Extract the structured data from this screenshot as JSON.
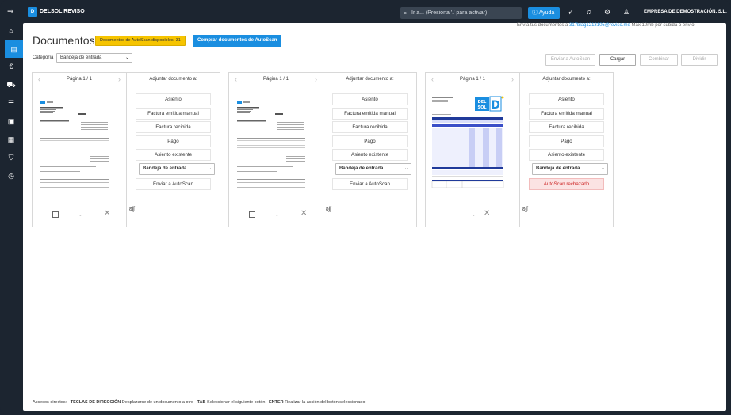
{
  "app": {
    "title": "DELSOL REVISO",
    "logo_text": "D"
  },
  "topbar": {
    "search_placeholder": "Ir a... (Presiona '.' para activar)",
    "help_label": "Ayuda",
    "company": "EMPRESA DE DEMOSTRACIÓN, S.L."
  },
  "header": {
    "email_note_prefix": "Envía tus documentos a ",
    "email": "317blag1213105@reviso.me",
    "email_note_suffix": " Max 10mb por subida o envío.",
    "title": "Documentos",
    "autoscan_badge": "Documentos de AutoScan disponibles: 31",
    "buy_button": "Comprar documentos de AutoScan"
  },
  "filter": {
    "category_label": "Categoría",
    "category_value": "Bandeja de entrada"
  },
  "toolbar": {
    "send_autoscan": "Enviar a AutoScan",
    "upload": "Cargar",
    "combine": "Combinar",
    "split": "Dividir"
  },
  "documents": [
    {
      "page": "Página 1 / 1",
      "attach_title": "Adjuntar documento a:",
      "options": [
        "Asiento",
        "Factura emitida manual",
        "Factura recibida",
        "Pago",
        "Asiento existente"
      ],
      "inbox": "Bandeja de entrada",
      "action": "Enviar a AutoScan",
      "note": "ʚʃʃ"
    },
    {
      "page": "Página 1 / 1",
      "attach_title": "Adjuntar documento a:",
      "options": [
        "Asiento",
        "Factura emitida manual",
        "Factura recibida",
        "Pago",
        "Asiento existente"
      ],
      "inbox": "Bandeja de entrada",
      "action": "Enviar a AutoScan",
      "note": "ʚʃʃ"
    },
    {
      "page": "Página 1 / 1",
      "attach_title": "Adjuntar documento a:",
      "options": [
        "Asiento",
        "Factura emitida manual",
        "Factura recibida",
        "Pago",
        "Asiento existente"
      ],
      "inbox": "Bandeja de entrada",
      "action": "AutoScan rechazado",
      "note": "ʚʃʃ"
    }
  ],
  "shortcuts": {
    "label": "Accesos directos:",
    "k1": "TECLAS DE DIRECCIÓN",
    "d1": "Desplazarse de un documento a otro",
    "k2": "TAB",
    "d2": "Seleccionar el siguiente botón",
    "k3": "ENTER",
    "d3": "Realizar la acción del botón seleccionado"
  },
  "colors": {
    "accent": "#1a8ee0",
    "sidebar": "#1c2530",
    "badge": "#f6c400",
    "rejected": "#c22222"
  }
}
